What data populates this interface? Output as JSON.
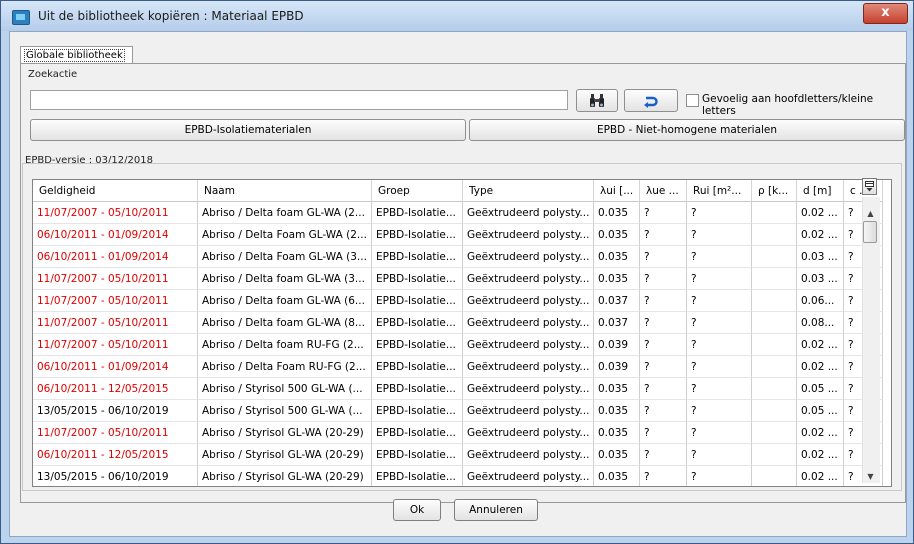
{
  "window": {
    "title": "Uit de bibliotheek kopiëren : Materiaal EPBD",
    "close_glyph": "x"
  },
  "tabs": [
    {
      "label": "Globale bibliotheek",
      "active": true
    }
  ],
  "search": {
    "group_label": "Zoekactie",
    "value": "",
    "find_icon": "binoculars-icon",
    "reset_icon": "undo-arrow-icon",
    "case_sensitive_label": "Gevoelig aan hoofdletters/kleine letters",
    "case_sensitive_checked": false
  },
  "filters": {
    "isolatie_label": "EPBD-Isolatiematerialen",
    "niet_homogeen_label": "EPBD - Niet-homogene materialen"
  },
  "version_label": "EPBD-versie : 03/12/2018",
  "table": {
    "columns": [
      "Geldigheid",
      "Naam",
      "Groep",
      "Type",
      "λui [...",
      "λue ...",
      "Rui [m²...",
      "ρ [k...",
      "d [m]",
      "c ..."
    ],
    "rows": [
      {
        "red": true,
        "cells": [
          "11/07/2007 - 05/10/2011",
          "Abriso / Delta foam GL-WA (2...",
          "EPBD-Isolatie...",
          "Geëxtrudeerd polysty...",
          "0.035",
          "?",
          "?",
          "",
          "0.02 ...",
          "?"
        ]
      },
      {
        "red": true,
        "cells": [
          "06/10/2011 - 01/09/2014",
          "Abriso / Delta Foam GL-WA (2...",
          "EPBD-Isolatie...",
          "Geëxtrudeerd polysty...",
          "0.035",
          "?",
          "?",
          "",
          "0.02 ...",
          "?"
        ]
      },
      {
        "red": true,
        "cells": [
          "06/10/2011 - 01/09/2014",
          "Abriso / Delta Foam GL-WA (3...",
          "EPBD-Isolatie...",
          "Geëxtrudeerd polysty...",
          "0.035",
          "?",
          "?",
          "",
          "0.03 ...",
          "?"
        ]
      },
      {
        "red": true,
        "cells": [
          "11/07/2007 - 05/10/2011",
          "Abriso / Delta foam GL-WA (3...",
          "EPBD-Isolatie...",
          "Geëxtrudeerd polysty...",
          "0.035",
          "?",
          "?",
          "",
          "0.03 ...",
          "?"
        ]
      },
      {
        "red": true,
        "cells": [
          "11/07/2007 - 05/10/2011",
          "Abriso / Delta foam GL-WA (6...",
          "EPBD-Isolatie...",
          "Geëxtrudeerd polysty...",
          "0.037",
          "?",
          "?",
          "",
          "0.06...",
          "?"
        ]
      },
      {
        "red": true,
        "cells": [
          "11/07/2007 - 05/10/2011",
          "Abriso / Delta foam GL-WA (8...",
          "EPBD-Isolatie...",
          "Geëxtrudeerd polysty...",
          "0.037",
          "?",
          "?",
          "",
          "0.08...",
          "?"
        ]
      },
      {
        "red": true,
        "cells": [
          "11/07/2007 - 05/10/2011",
          "Abriso / Delta foam RU-FG (2...",
          "EPBD-Isolatie...",
          "Geëxtrudeerd polysty...",
          "0.039",
          "?",
          "?",
          "",
          "0.02 ...",
          "?"
        ]
      },
      {
        "red": true,
        "cells": [
          "06/10/2011 - 01/09/2014",
          "Abriso / Delta Foam RU-FG (2...",
          "EPBD-Isolatie...",
          "Geëxtrudeerd polysty...",
          "0.039",
          "?",
          "?",
          "",
          "0.02 ...",
          "?"
        ]
      },
      {
        "red": true,
        "cells": [
          "06/10/2011 - 12/05/2015",
          "Abriso / Styrisol 500 GL-WA (...",
          "EPBD-Isolatie...",
          "Geëxtrudeerd polysty...",
          "0.035",
          "?",
          "?",
          "",
          "0.05 ...",
          "?"
        ]
      },
      {
        "red": false,
        "cells": [
          "13/05/2015 - 06/10/2019",
          "Abriso / Styrisol 500 GL-WA (...",
          "EPBD-Isolatie...",
          "Geëxtrudeerd polysty...",
          "0.035",
          "?",
          "?",
          "",
          "0.05 ...",
          "?"
        ]
      },
      {
        "red": true,
        "cells": [
          "11/07/2007 - 05/10/2011",
          "Abriso / Styrisol GL-WA (20-29)",
          "EPBD-Isolatie...",
          "Geëxtrudeerd polysty...",
          "0.035",
          "?",
          "?",
          "",
          "0.02 ...",
          "?"
        ]
      },
      {
        "red": true,
        "cells": [
          "06/10/2011 - 12/05/2015",
          "Abriso / Styrisol GL-WA (20-29)",
          "EPBD-Isolatie...",
          "Geëxtrudeerd polysty...",
          "0.035",
          "?",
          "?",
          "",
          "0.02 ...",
          "?"
        ]
      },
      {
        "red": false,
        "cells": [
          "13/05/2015 - 06/10/2019",
          "Abriso / Styrisol GL-WA (20-29)",
          "EPBD-Isolatie...",
          "Geëxtrudeerd polysty...",
          "0.035",
          "?",
          "?",
          "",
          "0.02 ...",
          "?"
        ]
      }
    ],
    "column_config_icon": "column-chooser-icon"
  },
  "dialog_buttons": {
    "ok_label": "Ok",
    "cancel_label": "Annuleren"
  },
  "colors": {
    "invalid_row": "#e00000",
    "title_bar": "#c4d9f1"
  }
}
